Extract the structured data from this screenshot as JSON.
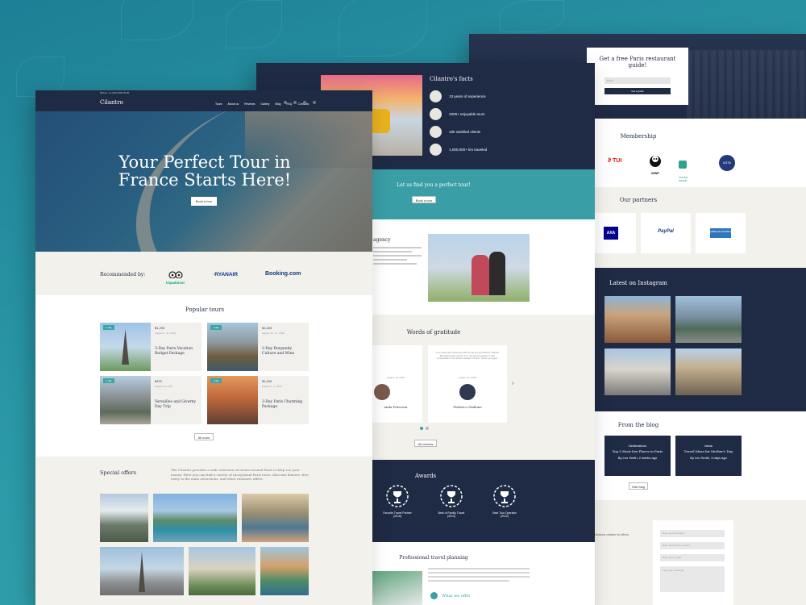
{
  "front": {
    "topbar": {
      "phone": "Phone: +1 (123) 456-78-90"
    },
    "logo": "Cilantro",
    "nav": [
      "Tours",
      "About us",
      "Reviews",
      "Gallery",
      "Blog",
      "FAQ",
      "Contacts"
    ],
    "hero": {
      "title_line1": "Your Perfect Tour in",
      "title_line2": "France Starts Here!",
      "button": "Book a tour"
    },
    "recommended": {
      "label": "Recommended by:",
      "logos": [
        "tripadvisor",
        "RYANAIR",
        "Booking.com"
      ]
    },
    "popular": {
      "title": "Popular tours",
      "tours": [
        {
          "badge": "1 day",
          "price": "$1,200",
          "dates": "August 8 - 11, 2018",
          "name": "3-Day Paris Vacation Budget Package"
        },
        {
          "badge": "1 day",
          "price": "$1,400",
          "dates": "August 15 - 17, 2018",
          "name": "2-Day Burgundy Culture and Wine"
        },
        {
          "badge": "1 day",
          "price": "$370",
          "dates": "August 19, 2018",
          "name": "Versailles and Giverny Day Trip"
        },
        {
          "badge": "1 day",
          "price": "$1,200",
          "dates": "August 2 - 4, 2018",
          "name": "3-Day Paris Charming Package"
        }
      ],
      "more_button": "All tours"
    },
    "special": {
      "title": "Special offers",
      "text": "The Cilantro provides a wide selection of venues around Paris to help see your money. Here you can find a variety of exceptional Paris tours, discount dinners, free entry to the main attractions, and other exclusive offers."
    }
  },
  "middle": {
    "facts": {
      "title": "Cilantro's facts",
      "items": [
        "13 years of experience",
        "2000+ enjoyable tours",
        "10k satisfied clients",
        "1,000,000+ km traveled"
      ]
    },
    "cta": {
      "title": "Let us find you a perfect tour!",
      "button": "Book a tour"
    },
    "agency": {
      "title": "agency"
    },
    "gratitude": {
      "title": "Words of gratitude",
      "reviews": [
        {
          "name": "anda Peterson",
          "date": "August 19, 2018"
        },
        {
          "name": "Federico Stallone",
          "date": "August 19, 2018",
          "quote": "\"I am extremely impressed with the service provided by Cilantro. Everything was perfect, from the accommodation to the composition of our dream vacation in Paris. Thank you guys!\""
        }
      ],
      "button": "All reviews"
    },
    "awards": {
      "title": "Awards",
      "items": [
        {
          "label": "Favorite Travel Partner",
          "year": "(2016)"
        },
        {
          "label": "Best of Family Travel",
          "year": "(2014)"
        },
        {
          "label": "Best Tour Operator",
          "year": "(2012)"
        }
      ]
    },
    "planning": {
      "title": "Professional travel planning",
      "subtitle": "What we offer"
    }
  },
  "back": {
    "guide": {
      "title_line1": "Get a free Paris restaurant",
      "title_line2": "guide!",
      "email_placeholder": "Email",
      "button": "Get a guide"
    },
    "membership": {
      "title": "Membership",
      "logos": [
        "TUI",
        "WWF",
        "exodus travels",
        "ASTA"
      ]
    },
    "partners": {
      "title": "Our partners",
      "logos": [
        "AXA",
        "PayPal",
        "AMERICAN EXPRESS"
      ]
    },
    "instagram": {
      "title": "Latest on Instagram"
    },
    "blog": {
      "title": "From the blog",
      "posts": [
        {
          "category": "Destinations",
          "title": "Top 5 Must-See Places in Paris",
          "author": "By Leo Smith, 2 weeks ago"
        },
        {
          "category": "Ideas",
          "title": "Travel Ideas for Mother's Day",
          "author": "By Leo Smith, 3 days ago"
        }
      ],
      "button": "Visit blog"
    },
    "contact": {
      "text": "questions related to offers",
      "fields": [
        "Enter your full name",
        "Enter your phone number",
        "Enter your e-mail",
        "Type your message"
      ]
    }
  },
  "colors": {
    "navy": "#1f2a44",
    "teal": "#3aa6a8",
    "background": "#2a97a6",
    "cream": "#f3f1ec"
  }
}
